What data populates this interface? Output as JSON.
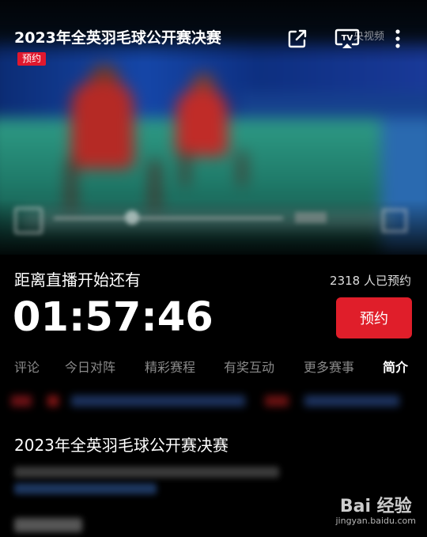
{
  "player": {
    "title": "2023年全英羽毛球公开赛决赛",
    "badge": "预约",
    "brand": "央视频"
  },
  "countdown": {
    "label": "距离直播开始还有",
    "time": "01:57:46",
    "reserve_count": "2318 人已预约",
    "reserve_button": "预约"
  },
  "tabs": [
    {
      "label": "评论"
    },
    {
      "label": "今日对阵"
    },
    {
      "label": "精彩赛程"
    },
    {
      "label": "有奖互动"
    },
    {
      "label": "更多赛事"
    },
    {
      "label": "简介"
    }
  ],
  "intro": {
    "title": "2023年全英羽毛球公开赛决赛"
  },
  "watermark": {
    "logo": "Bai 经验",
    "url": "jingyan.baidu.com"
  },
  "colors": {
    "accent": "#e01e2a",
    "background": "#000000"
  },
  "icons": [
    "share-icon",
    "tv-cast-icon",
    "more-vertical-icon",
    "play-icon",
    "fullscreen-icon"
  ]
}
